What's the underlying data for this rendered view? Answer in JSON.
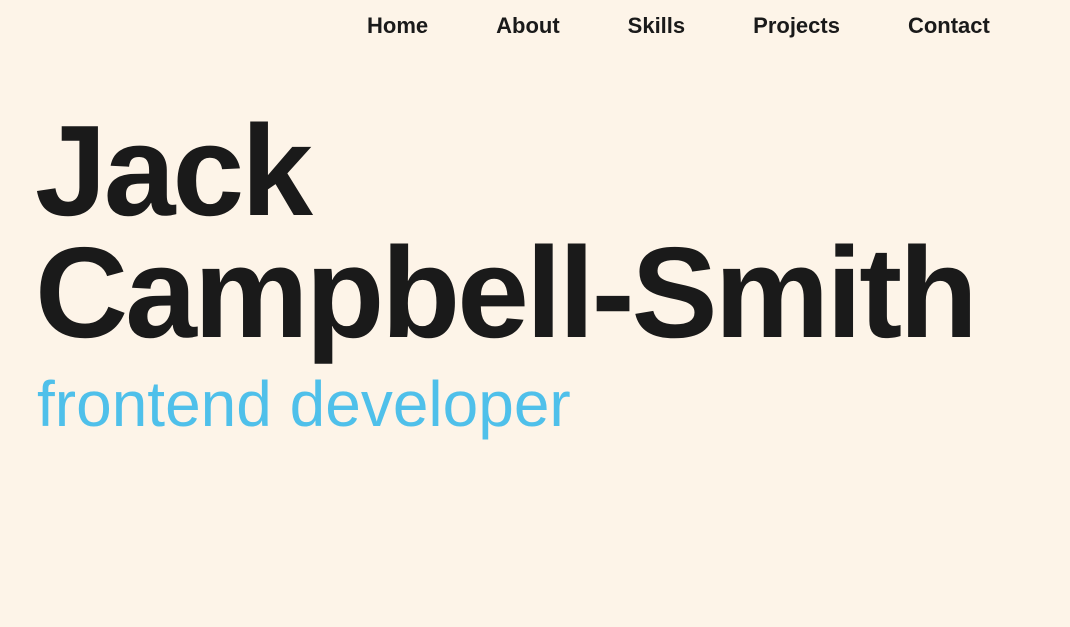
{
  "nav": {
    "items": [
      {
        "label": "Home"
      },
      {
        "label": "About"
      },
      {
        "label": "Skills"
      },
      {
        "label": "Projects"
      },
      {
        "label": "Contact"
      }
    ]
  },
  "hero": {
    "first_name": "Jack",
    "last_name": "Campbell-Smith",
    "role": "frontend developer"
  },
  "colors": {
    "background": "#fdf4e8",
    "text": "#1a1a1a",
    "accent": "#4fc0ea"
  }
}
